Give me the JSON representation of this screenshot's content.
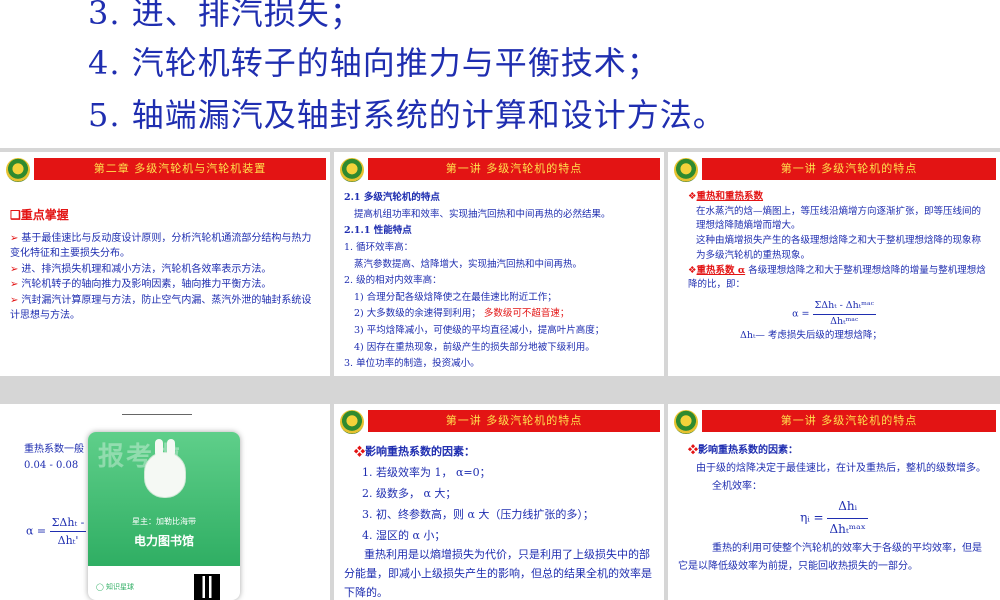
{
  "top_list": [
    "3. 进、排汽损失；",
    "4. 汽轮机转子的轴向推力与平衡技术；",
    "5. 轴端漏汽及轴封系统的计算和设计方法。"
  ],
  "slide1": {
    "header": "第二章  多级汽轮机与汽轮机装置",
    "heading": "❑重点掌握",
    "bullets": [
      "基于最佳速比与反动度设计原则，分析汽轮机通流部分结构与热力变化特征和主要损失分布。",
      "进、排汽损失机理和减小方法，汽轮机各效率表示方法。",
      "汽轮机转子的轴向推力及影响因素，轴向推力平衡方法。",
      "汽封漏汽计算原理与方法，防止空气内漏、蒸汽外泄的轴封系统设计思想与方法。"
    ]
  },
  "slide2": {
    "header": "第一讲   多级汽轮机的特点",
    "lines": [
      "2.1  多级汽轮机的特点",
      "提高机组功率和效率、实现抽汽回热和中间再热的必然结果。",
      "2.1.1  性能特点",
      "1. 循环效率高：",
      "蒸汽参数提高、焓降增大，实现抽汽回热和中间再热。",
      "2. 级的相对内效率高：",
      "1) 合理分配各级焓降使之在最佳速比附近工作；",
      "2) 大多数级的余速得到利用；",
      "多数级可不超音速；",
      "3) 平均焓降减小，可使级的平均直径减小，提高叶片高度；",
      "4) 因存在重热现象，前级产生的损失部分地被下级利用。",
      "3. 单位功率的制造，投资减小。"
    ]
  },
  "slide3": {
    "header": "第一讲   多级汽轮机的特点",
    "heading": "重热和重热系数",
    "p1": "在水蒸汽的焓—熵图上，等压线沿熵增方向逐渐扩张，即等压线间的理想焓降随熵增而增大。",
    "p2": "这种由熵增损失产生的各级理想焓降之和大于整机理想焓降的现象称为多级汽轮机的重热现象。",
    "p3_label": "重热系数 α",
    "p3": "各级理想焓降之和大于整机理想焓降的增量与整机理想焓降的比，即：",
    "formula_num": "ΣΔhₜ - Δhₜᵐᵃᶜ",
    "formula_den": "Δhₜᵐᵃᶜ",
    "formula_lhs": "α =",
    "note": "Δhₜ— 考虑损失后级的理想焓降；"
  },
  "slide4": {
    "text1": "重热系数一般",
    "text2": "0.04 - 0.08",
    "formula_lhs": "α =",
    "formula_num": "ΣΔhₜ -",
    "formula_den": "Δhₜ'"
  },
  "overlay_card": {
    "ghost": "报考啦",
    "sub": "星主：加勒比海带",
    "title": "电力图书馆",
    "bottom": "◯ 知识星球"
  },
  "slide5": {
    "header": "第一讲   多级汽轮机的特点",
    "heading": "影响重热系数的因素：",
    "items": [
      "1. 若级效率为 1，  α=0；",
      "2. 级数多，   α 大；",
      "3. 初、终参数高，则 α 大（压力线扩张的多）；",
      "4. 湿区的 α 小；"
    ],
    "para": "重热利用是以熵增损失为代价，只是利用了上级损失中的部分能量，即减小上级损失产生的影响，但总的结果全机的效率是下降的。"
  },
  "slide6": {
    "header": "第一讲   多级汽轮机的特点",
    "heading": "影响重热系数的因素：",
    "p1": "由于级的焓降决定于最佳速比，在计及重热后，整机的级数增多。",
    "p2": "全机效率：",
    "formula_lhs": "ηᵢ =",
    "formula_num": "Δhᵢ",
    "formula_den": "Δhₜᵐᵃˣ",
    "p3": "重热的利用可使整个汽轮机的效率大于各级的平均效率，但是它是以降低级效率为前提，只能回收热损失的一部分。"
  },
  "colors": {
    "header_red": "#e31414",
    "header_text": "#ffe14d",
    "body_blue": "#1f2eb0"
  }
}
